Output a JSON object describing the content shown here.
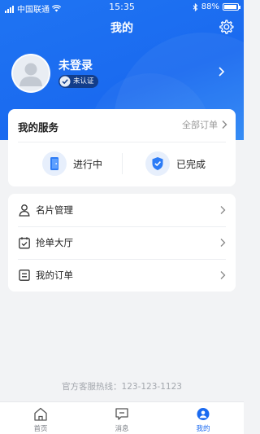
{
  "statusbar": {
    "carrier": "中国联通",
    "time": "15:35",
    "battery": "88%",
    "battery_level": 0.88
  },
  "navbar": {
    "title": "我的",
    "settings_icon": "gear-icon"
  },
  "profile": {
    "name": "未登录",
    "badge": "未认证",
    "avatar_icon": "user-avatar-icon"
  },
  "services": {
    "title": "我的服务",
    "all_orders": "全部订单",
    "items": [
      {
        "label": "进行中",
        "icon": "in-progress-icon"
      },
      {
        "label": "已完成",
        "icon": "completed-shield-icon"
      }
    ]
  },
  "menu": {
    "items": [
      {
        "label": "名片管理",
        "icon": "person-icon"
      },
      {
        "label": "抢单大厅",
        "icon": "calendar-check-icon"
      },
      {
        "label": "我的订单",
        "icon": "list-icon"
      }
    ]
  },
  "hotline": "官方客服热线：123-123-1123",
  "tabbar": {
    "tabs": [
      {
        "label": "首页",
        "icon": "home-icon",
        "active": false
      },
      {
        "label": "消息",
        "icon": "message-icon",
        "active": false
      },
      {
        "label": "我的",
        "icon": "profile-icon",
        "active": true
      }
    ]
  },
  "colors": {
    "primary": "#1a6af0",
    "background": "#f2f3f5",
    "badge": "#123d8a"
  }
}
